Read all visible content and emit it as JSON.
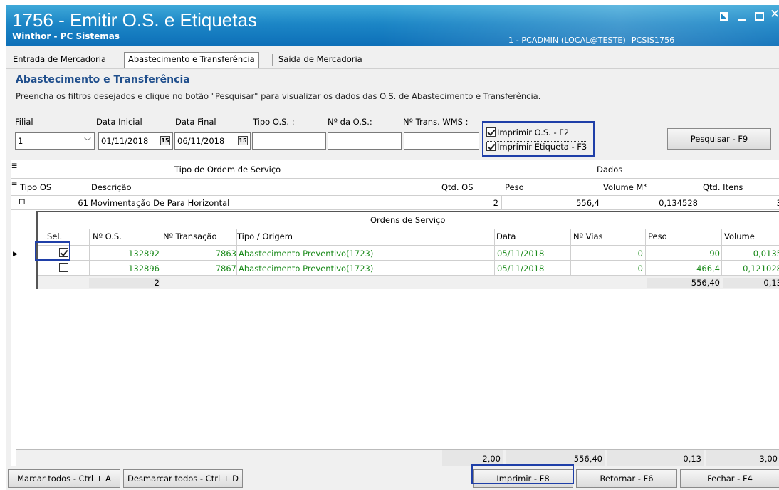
{
  "window": {
    "title": "1756 - Emitir O.S. e Etiquetas",
    "subtitle": "Winthor - PC Sistemas",
    "session_user": "1 - PCADMIN (LOCAL@TESTE)",
    "session_routine": "PCSIS1756"
  },
  "tabs": [
    {
      "label": "Entrada de Mercadoria"
    },
    {
      "label": "Abastecimento e Transferência"
    },
    {
      "label": "Saída de Mercadoria"
    }
  ],
  "section": {
    "title": "Abastecimento e Transferência",
    "description": "Preencha os filtros desejados e clique no botão \"Pesquisar\" para visualizar os dados das O.S. de Abastecimento e Transferência."
  },
  "filters": {
    "filial_label": "Filial",
    "filial_value": "1",
    "data_inicial_label": "Data Inicial",
    "data_inicial_value": "01/11/2018",
    "data_final_label": "Data Final",
    "data_final_value": "06/11/2018",
    "tipo_os_label": "Tipo O.S. :",
    "tipo_os_value": "",
    "num_os_label": "Nº da O.S.:",
    "num_os_value": "",
    "num_trans_label": "Nº Trans. WMS :",
    "num_trans_value": "",
    "calendar_glyph": "15"
  },
  "options": {
    "imprimir_os": {
      "label": "Imprimir O.S. - F2",
      "checked": true
    },
    "imprimir_etiqueta": {
      "label": "Imprimir Etiqueta - F3",
      "checked": true
    }
  },
  "buttons": {
    "pesquisar": "Pesquisar - F9",
    "marcar_todos": "Marcar todos - Ctrl + A",
    "desmarcar_todos": "Desmarcar todos - Ctrl + D",
    "imprimir": "Imprimir - F8",
    "retornar": "Retornar - F6",
    "fechar": "Fechar - F4"
  },
  "master_grid": {
    "group_header_left": "Tipo de Ordem de Serviço",
    "group_header_right": "Dados",
    "columns": [
      "Tipo OS",
      "Descrição",
      "Qtd. OS",
      "Peso",
      "Volume M³",
      "Qtd. Itens"
    ],
    "row": {
      "expand_glyph": "⊟",
      "tipo_os": "61",
      "descricao": "Movimentação De Para Horizontal",
      "qtd_os": "2",
      "peso": "556,4",
      "volume": "0,134528",
      "qtd_itens": "3"
    }
  },
  "detail_grid": {
    "title": "Ordens de Serviço",
    "columns": [
      "Sel.",
      "Nº O.S.",
      "Nº Transação",
      "Tipo / Origem",
      "Data",
      "Nº Vias",
      "Peso",
      "Volume"
    ],
    "rows": [
      {
        "selected": true,
        "num_os": "132892",
        "transacao": "7863",
        "tipo_origem": "Abastecimento Preventivo(1723)",
        "data": "05/11/2018",
        "vias": "0",
        "peso": "90",
        "volume": "0,0135"
      },
      {
        "selected": false,
        "num_os": "132896",
        "transacao": "7867",
        "tipo_origem": "Abastecimento Preventivo(1723)",
        "data": "05/11/2018",
        "vias": "0",
        "peso": "466,4",
        "volume": "0,121028"
      }
    ],
    "footer": {
      "count": "2",
      "peso": "556,40",
      "volume": "0,13"
    }
  },
  "totals": {
    "qtd_os": "2,00",
    "peso": "556,40",
    "volume": "0,13",
    "qtd_itens": "3,00"
  }
}
